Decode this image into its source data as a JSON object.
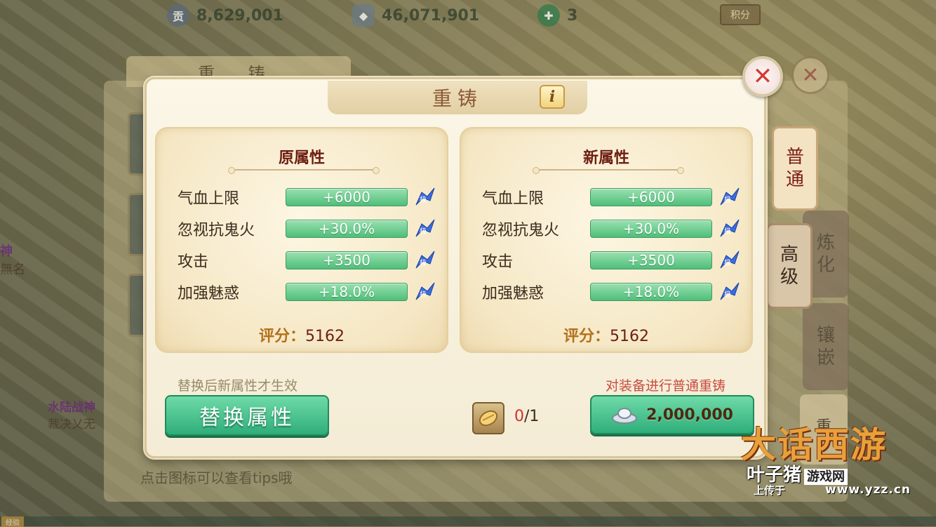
{
  "topbar": {
    "contribution": "8,629,001",
    "silver": "46,071,901",
    "jade": "3",
    "points_label": "积分"
  },
  "background": {
    "panel_title": "重 铸",
    "tips": "点击图标可以查看tips哦",
    "side_text_1": "神",
    "side_text_2": "無名",
    "side_text_3": "水陆战神",
    "side_text_4": "裁决乂无",
    "chat_tag": "经验",
    "tab_chong": "重"
  },
  "tabs": {
    "normal": [
      "普",
      "通"
    ],
    "advanced": [
      "高",
      "级"
    ],
    "refine": [
      "炼",
      "化"
    ],
    "inlay": [
      "镶",
      "嵌"
    ]
  },
  "dialog": {
    "title": "重铸",
    "info_label": "i",
    "close_label": "✕",
    "original": {
      "header": "原属性",
      "attributes": [
        {
          "name": "气血上限",
          "value": "+6000"
        },
        {
          "name": "忽视抗鬼火",
          "value": "+30.0%"
        },
        {
          "name": "攻击",
          "value": "+3500"
        },
        {
          "name": "加强魅惑",
          "value": "+18.0%"
        }
      ],
      "score_label": "评分：",
      "score_value": "5162"
    },
    "new": {
      "header": "新属性",
      "attributes": [
        {
          "name": "气血上限",
          "value": "+6000"
        },
        {
          "name": "忽视抗鬼火",
          "value": "+30.0%"
        },
        {
          "name": "攻击",
          "value": "+3500"
        },
        {
          "name": "加强魅惑",
          "value": "+18.0%"
        }
      ],
      "score_label": "评分：",
      "score_value": "5162"
    },
    "hint_left": "替换后新属性才生效",
    "hint_right": "对装备进行普通重铸",
    "replace_button": "替换属性",
    "material_have": "0",
    "material_need": "/1",
    "cost": "2,000,000"
  },
  "watermark": {
    "logo": "大话西游",
    "site": "叶子猪",
    "site_box": "游戏网",
    "uploaded": "上传于",
    "url": "www.yzz.cn"
  },
  "colors": {
    "accent_green": "#2fae7a",
    "title_brown": "#8a5a35",
    "header_red": "#6d1e12",
    "hint_red": "#c84c40"
  }
}
